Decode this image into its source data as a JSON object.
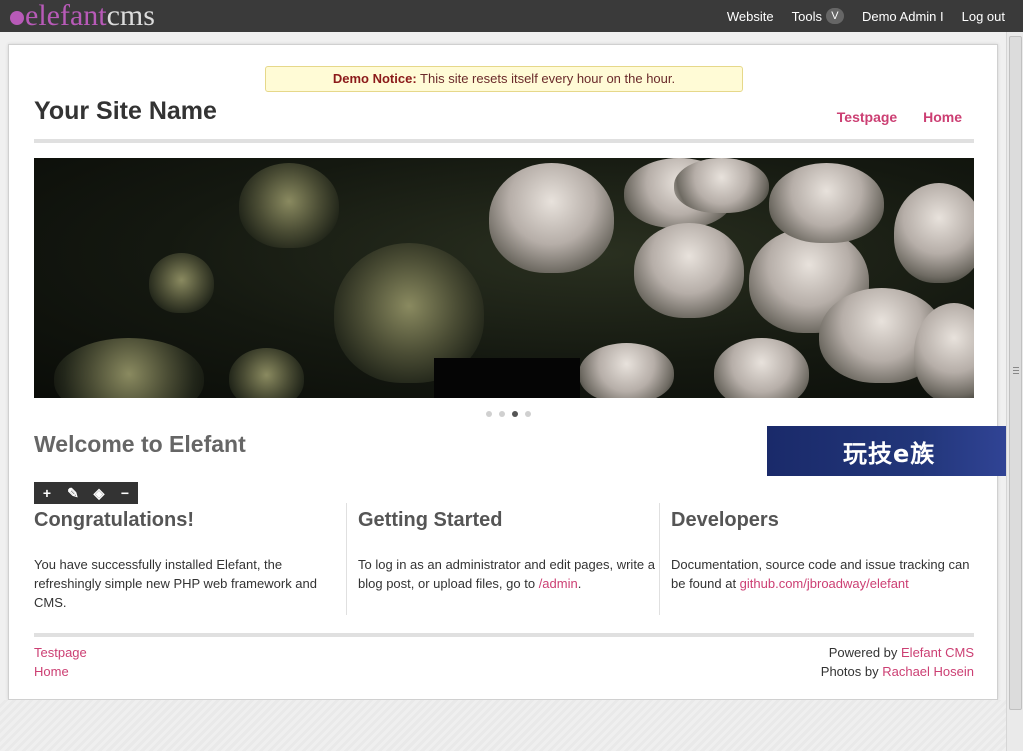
{
  "topbar": {
    "logo_part1": "elefant",
    "logo_part2": "cms",
    "nav": {
      "website": "Website",
      "tools": "Tools",
      "tools_badge": "V",
      "user": "Demo Admin I",
      "logout": "Log out"
    }
  },
  "notice": {
    "label": "Demo Notice:",
    "text": "This site resets itself every hour on the hour."
  },
  "header": {
    "site_name": "Your Site Name",
    "nav": [
      "Testpage",
      "Home"
    ]
  },
  "welcome_title": "Welcome to Elefant",
  "watermark_text": "玩技e族",
  "edit_toolbar": {
    "icons": [
      "plus-icon",
      "pencil-icon",
      "layers-icon",
      "minus-icon"
    ],
    "glyphs": [
      "+",
      "✎",
      "◈",
      "−"
    ]
  },
  "columns": [
    {
      "title": "Congratulations!",
      "text": "You have successfully installed Elefant, the refreshingly simple new PHP web framework and CMS."
    },
    {
      "title": "Getting Started",
      "text": "To log in as an administrator and edit pages, write a blog post, or upload files, go to ",
      "link": "/admin",
      "suffix": "."
    },
    {
      "title": "Developers",
      "text": "Documentation, source code and issue tracking can be found at ",
      "link": "github.com/jbroadway/elefant"
    }
  ],
  "slider": {
    "count": 4,
    "active_index": 2
  },
  "footer": {
    "links": [
      "Testpage",
      "Home"
    ],
    "powered_prefix": "Powered by ",
    "powered_link": "Elefant CMS",
    "photos_prefix": "Photos by ",
    "photos_link": "Rachael Hosein"
  },
  "colors": {
    "accent": "#cc3f73",
    "topbar": "#3a3a3a",
    "logo": "#b85ab8"
  }
}
